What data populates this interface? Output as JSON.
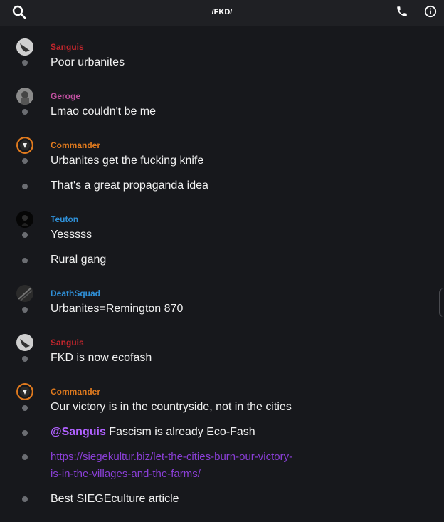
{
  "header": {
    "title": "/FKD/",
    "icons": [
      "search-icon",
      "phone-icon",
      "info-icon"
    ]
  },
  "colors": {
    "sanguis": "#c0262d",
    "geroge": "#c050a0",
    "commander": "#e07a1e",
    "teuton": "#2f8fd6",
    "deathsquad": "#2f8fd6",
    "mention": "#b061ff",
    "link": "#8a3fd6"
  },
  "messages": [
    {
      "author": "Sanguis",
      "lines": [
        "Poor urbanites"
      ]
    },
    {
      "author": "Geroge",
      "lines": [
        "Lmao couldn't be me"
      ]
    },
    {
      "author": "Commander",
      "lines": [
        "Urbanites get the fucking knife",
        "That's a great propaganda idea"
      ]
    },
    {
      "author": "Teuton",
      "lines": [
        "Yesssss",
        "Rural gang"
      ]
    },
    {
      "author": "DeathSquad",
      "lines": [
        "Urbanites=Remington 870"
      ]
    },
    {
      "author": "Sanguis",
      "lines": [
        "FKD is now ecofash"
      ]
    },
    {
      "author": "Commander",
      "lines": [
        "Our victory is in the countryside, not in the cities"
      ],
      "mention_line": {
        "mention": "@Sanguis",
        "text": " Fascism is already Eco-Fash"
      },
      "link_line": {
        "url_1": "https://siegekultur.biz/let-the-cities-burn-our-victory-",
        "url_2": "is-in-the-villages-and-the-farms/"
      },
      "last_line": "Best SIEGEculture article"
    }
  ]
}
